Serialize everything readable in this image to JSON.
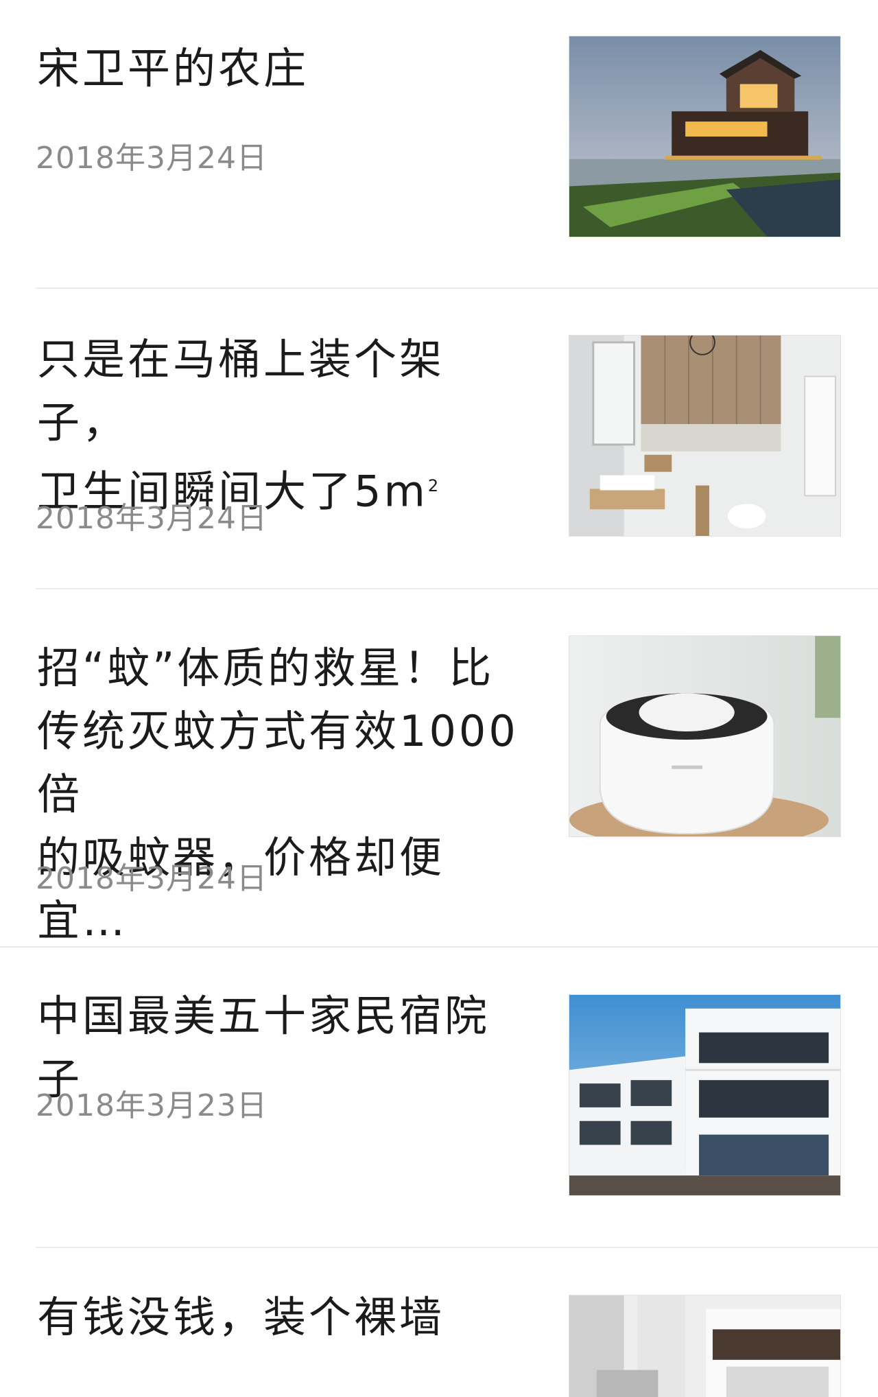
{
  "articles": [
    {
      "title": "宋卫平的农庄",
      "date": "2018年3月24日",
      "thumbnail": "farmhouse-lakeside-garden"
    },
    {
      "title_line1": "只是在马桶上装个架子，",
      "title_line2_prefix": "卫生间瞬间大了5m",
      "title_superscript": "2",
      "date": "2018年3月24日",
      "thumbnail": "bathroom-shelf-interior"
    },
    {
      "title_line1": "招“蚊”体质的救星！比",
      "title_line2": "传统灭蚊方式有效1000倍",
      "title_line3": "的吸蚊器，价格却便宜…",
      "date": "2018年3月24日",
      "thumbnail": "white-mosquito-trap"
    },
    {
      "title": "中国最美五十家民宿院子",
      "date": "2018年3月23日",
      "thumbnail": "white-modern-guesthouse"
    },
    {
      "title": "有钱没钱，装个裸墙",
      "thumbnail": "bare-wall-living-room"
    }
  ]
}
